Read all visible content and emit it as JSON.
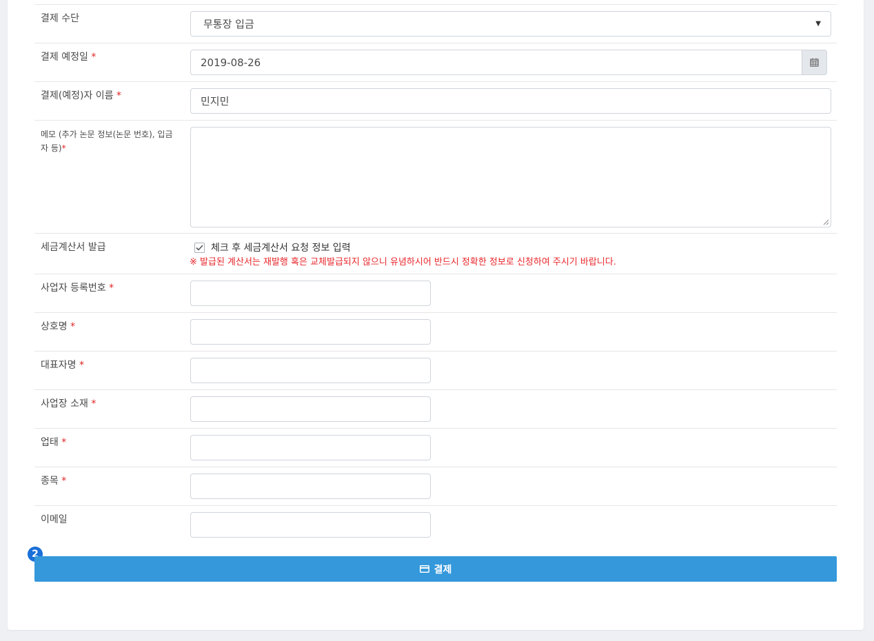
{
  "form": {
    "payment_method": {
      "label": "결제 수단",
      "value": "무통장 입금"
    },
    "payment_date": {
      "label": "결제 예정일",
      "required_mark": "*",
      "value": "2019-08-26"
    },
    "payer_name": {
      "label": "결제(예정)자 이름",
      "required_mark": "*",
      "value": "민지민"
    },
    "memo": {
      "label": "메모 (추가 논문 정보(논문 번호), 입금자 등)",
      "required_mark": "*",
      "value": ""
    },
    "tax_invoice": {
      "label": "세금계산서 발급",
      "checkbox_label": "체크 후 세금계산서 요청 정보 입력",
      "checked": true,
      "notice": "※ 발급된 계산서는 재발행 혹은 교체발급되지 않으니 유념하시어 반드시 정확한 정보로 신청하여 주시기 바랍니다."
    },
    "business_number": {
      "label": "사업자 등록번호",
      "required_mark": "*",
      "value": ""
    },
    "company_name": {
      "label": "상호명",
      "required_mark": "*",
      "value": ""
    },
    "representative": {
      "label": "대표자명",
      "required_mark": "*",
      "value": ""
    },
    "business_address": {
      "label": "사업장 소재",
      "required_mark": "*",
      "value": ""
    },
    "business_type": {
      "label": "업태",
      "required_mark": "*",
      "value": ""
    },
    "business_item": {
      "label": "종목",
      "required_mark": "*",
      "value": ""
    },
    "email": {
      "label": "이메일",
      "value": ""
    }
  },
  "step_badge": "2",
  "pay_button": {
    "label": "결제",
    "icon": "credit-card-icon"
  },
  "colors": {
    "primary": "#3498db",
    "required": "#e02424",
    "notice": "#e8262b",
    "badge": "#1a6fd8"
  }
}
